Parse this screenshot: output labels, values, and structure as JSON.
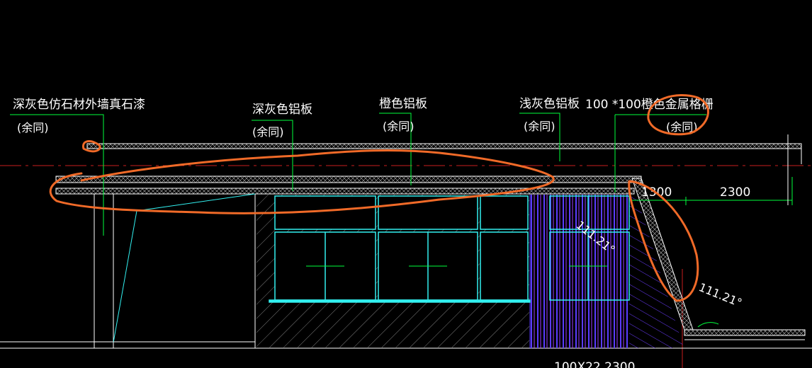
{
  "labels": {
    "stone_paint": "深灰色仿石材外墙真石漆",
    "stone_paint_note": "(余同)",
    "dark_grey_panel": "深灰色铝板",
    "dark_grey_panel_note": "(余同)",
    "orange_panel": "橙色铝板",
    "orange_panel_note": "(余同)",
    "light_grey_panel": "浅灰色铝板",
    "light_grey_panel_note": "(余同)",
    "orange_grille": "100 *100橙色金属格栅",
    "orange_grille_note": "(余同)"
  },
  "dimensions": {
    "dim_1300": "1300",
    "dim_2300": "2300",
    "bottom_dim": "100X22 2300",
    "angle_upper": "111.21°",
    "angle_lower": "111.21°"
  },
  "colors": {
    "background": "#000000",
    "line_white": "#ffffff",
    "leader_green": "#00ff3c",
    "window_cyan": "#32f0f0",
    "grille_blue": "#5a3cff",
    "grille_purple": "#9c3cff",
    "annotation_orange": "#f06a28",
    "axis_red": "#c81e1e",
    "hatch_grey": "#9a9a9a"
  }
}
